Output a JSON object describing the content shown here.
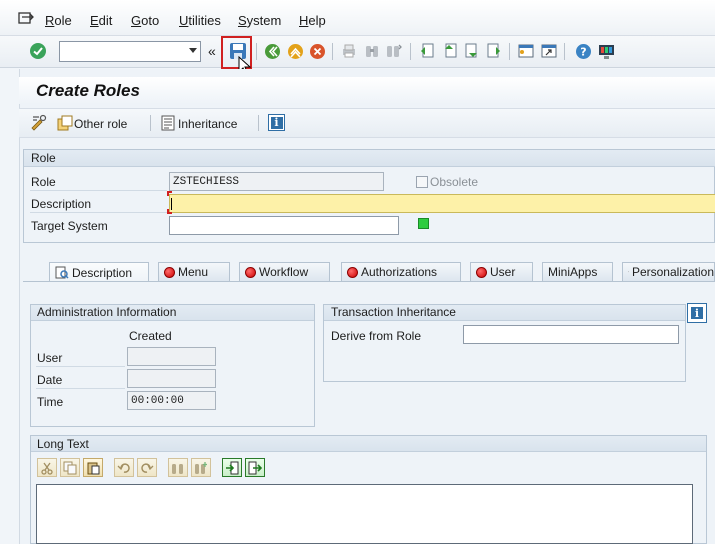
{
  "menubar": {
    "items": [
      {
        "label": "Role",
        "key": "R",
        "rest": "ole"
      },
      {
        "label": "Edit",
        "key": "E",
        "rest": "dit"
      },
      {
        "label": "Goto",
        "key": "G",
        "rest": "oto"
      },
      {
        "label": "Utilities",
        "key": "U",
        "rest": "tilities"
      },
      {
        "label": "System",
        "key": "S",
        "rest": "ystem"
      },
      {
        "label": "Help",
        "key": "H",
        "rest": "elp"
      }
    ]
  },
  "toolbar": {
    "command_field_value": "",
    "expand_glyph": "«",
    "icons": [
      "enter-icon",
      "save-icon",
      "back-icon",
      "exit-icon",
      "cancel-icon",
      "print-icon",
      "find-icon",
      "find-next-icon",
      "first-page-icon",
      "previous-page-icon",
      "next-page-icon",
      "last-page-icon",
      "create-session-icon",
      "shortcut-icon",
      "help-icon",
      "customize-layout-icon"
    ]
  },
  "page": {
    "title": "Create Roles"
  },
  "app_toolbar": {
    "other_role_label": "Other role",
    "inheritance_label": "Inheritance",
    "info_glyph": "i"
  },
  "role_group": {
    "header": "Role",
    "role_label": "Role",
    "role_value": "ZSTECHIESS",
    "obsolete_label": "Obsolete",
    "description_label": "Description",
    "description_value": "",
    "target_system_label": "Target System",
    "target_system_value": "",
    "status_color": "#2ecc40"
  },
  "tabs": [
    {
      "label": "Description",
      "status": "active"
    },
    {
      "label": "Menu",
      "status": "red"
    },
    {
      "label": "Workflow",
      "status": "red"
    },
    {
      "label": "Authorizations",
      "status": "red"
    },
    {
      "label": "User",
      "status": "red"
    },
    {
      "label": "MiniApps",
      "status": "none"
    },
    {
      "label": "Personalization",
      "status": "personalization"
    }
  ],
  "admin_info": {
    "header": "Administration Information",
    "created_label": "Created",
    "user_label": "User",
    "user_value": "",
    "date_label": "Date",
    "date_value": "",
    "time_label": "Time",
    "time_value": "00:00:00"
  },
  "transaction_inheritance": {
    "header": "Transaction Inheritance",
    "derive_label": "Derive from Role",
    "derive_value": ""
  },
  "long_text": {
    "header": "Long Text",
    "buttons": [
      "cut-icon",
      "copy-icon",
      "paste-icon",
      "undo-icon",
      "redo-icon",
      "find-icon",
      "find-next-icon",
      "import-icon",
      "export-icon"
    ]
  },
  "colors": {
    "highlight_red": "#d02020",
    "required_yellow": "#fdf1a8",
    "status_error_red": "#cc0000",
    "status_ok_green": "#2ecc40",
    "accent_blue": "#2f6ea5"
  }
}
